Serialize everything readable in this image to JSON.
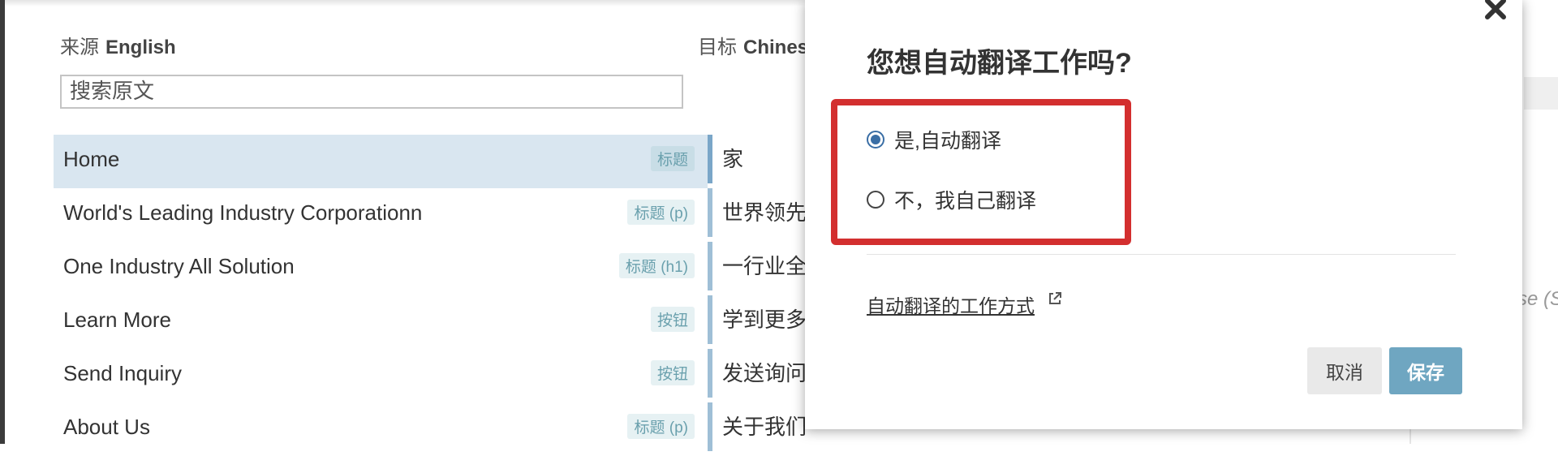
{
  "source": {
    "prefix": "来源",
    "language": "English"
  },
  "target": {
    "prefix": "目标",
    "language": "Chines"
  },
  "search": {
    "placeholder": "搜索原文"
  },
  "rows": [
    {
      "text": "Home",
      "tag": "标题",
      "translation": "家"
    },
    {
      "text": "World's Leading Industry Corporationn",
      "tag": "标题 (p)",
      "translation": "世界领先"
    },
    {
      "text": "One Industry All Solution",
      "tag": "标题 (h1)",
      "translation": "一行业全"
    },
    {
      "text": "Learn More",
      "tag": "按钮",
      "translation": "学到更多"
    },
    {
      "text": "Send Inquiry",
      "tag": "按钮",
      "translation": "发送询问"
    },
    {
      "text": "About Us",
      "tag": "标题 (p)",
      "translation": "关于我们"
    }
  ],
  "background_right": {
    "text": "se (S"
  },
  "modal": {
    "title": "您想自动翻译工作吗?",
    "options": [
      {
        "label": "是,自动翻译",
        "checked": true
      },
      {
        "label": "不，我自己翻译",
        "checked": false
      }
    ],
    "help_link": "自动翻译的工作方式",
    "cancel_label": "取消",
    "save_label": "保存"
  },
  "colors": {
    "accent": "#6fa6c1",
    "radio_selected": "#3a6ea5",
    "highlight": "#d32f2f",
    "tag_text": "#6aa0ad",
    "selected_row": "#d9e6f0"
  },
  "icons": [
    "close-icon",
    "external-link-icon"
  ]
}
